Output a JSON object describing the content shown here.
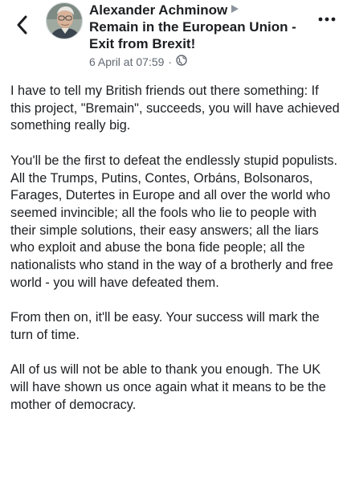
{
  "header": {
    "author": "Alexander Achminow",
    "group": "Remain in the European Union - Exit from Brexit!",
    "timestamp": "6 April at 07:59",
    "separator": "·",
    "back_icon": "chevron-left-icon",
    "more_icon": "ellipsis-icon",
    "privacy_icon": "globe-icon",
    "arrow_icon": "triangle-right-icon"
  },
  "post": {
    "paragraphs": [
      "I have to tell my British friends out there something: If this project, \"Bremain\", succeeds, you will have achieved something really big.",
      "You'll be the first to defeat the endlessly stupid populists. All the Trumps, Putins, Contes, Orbáns, Bolsonaros, Farages, Dutertes in Europe and all over the world who seemed invincible; all the fools who lie to people with their simple solutions, their easy answers; all the liars who exploit and abuse the bona fide people; all the nationalists who stand in the way of a brotherly and free world - you will have defeated them.",
      "From then on, it'll be easy. Your success will mark the turn of time.",
      "All of us will not be able to thank you enough. The UK will have shown us once again what it means to be the mother of democracy."
    ]
  },
  "colors": {
    "text": "#1c1e21",
    "secondary": "#606770",
    "arrow": "#8d949e"
  }
}
